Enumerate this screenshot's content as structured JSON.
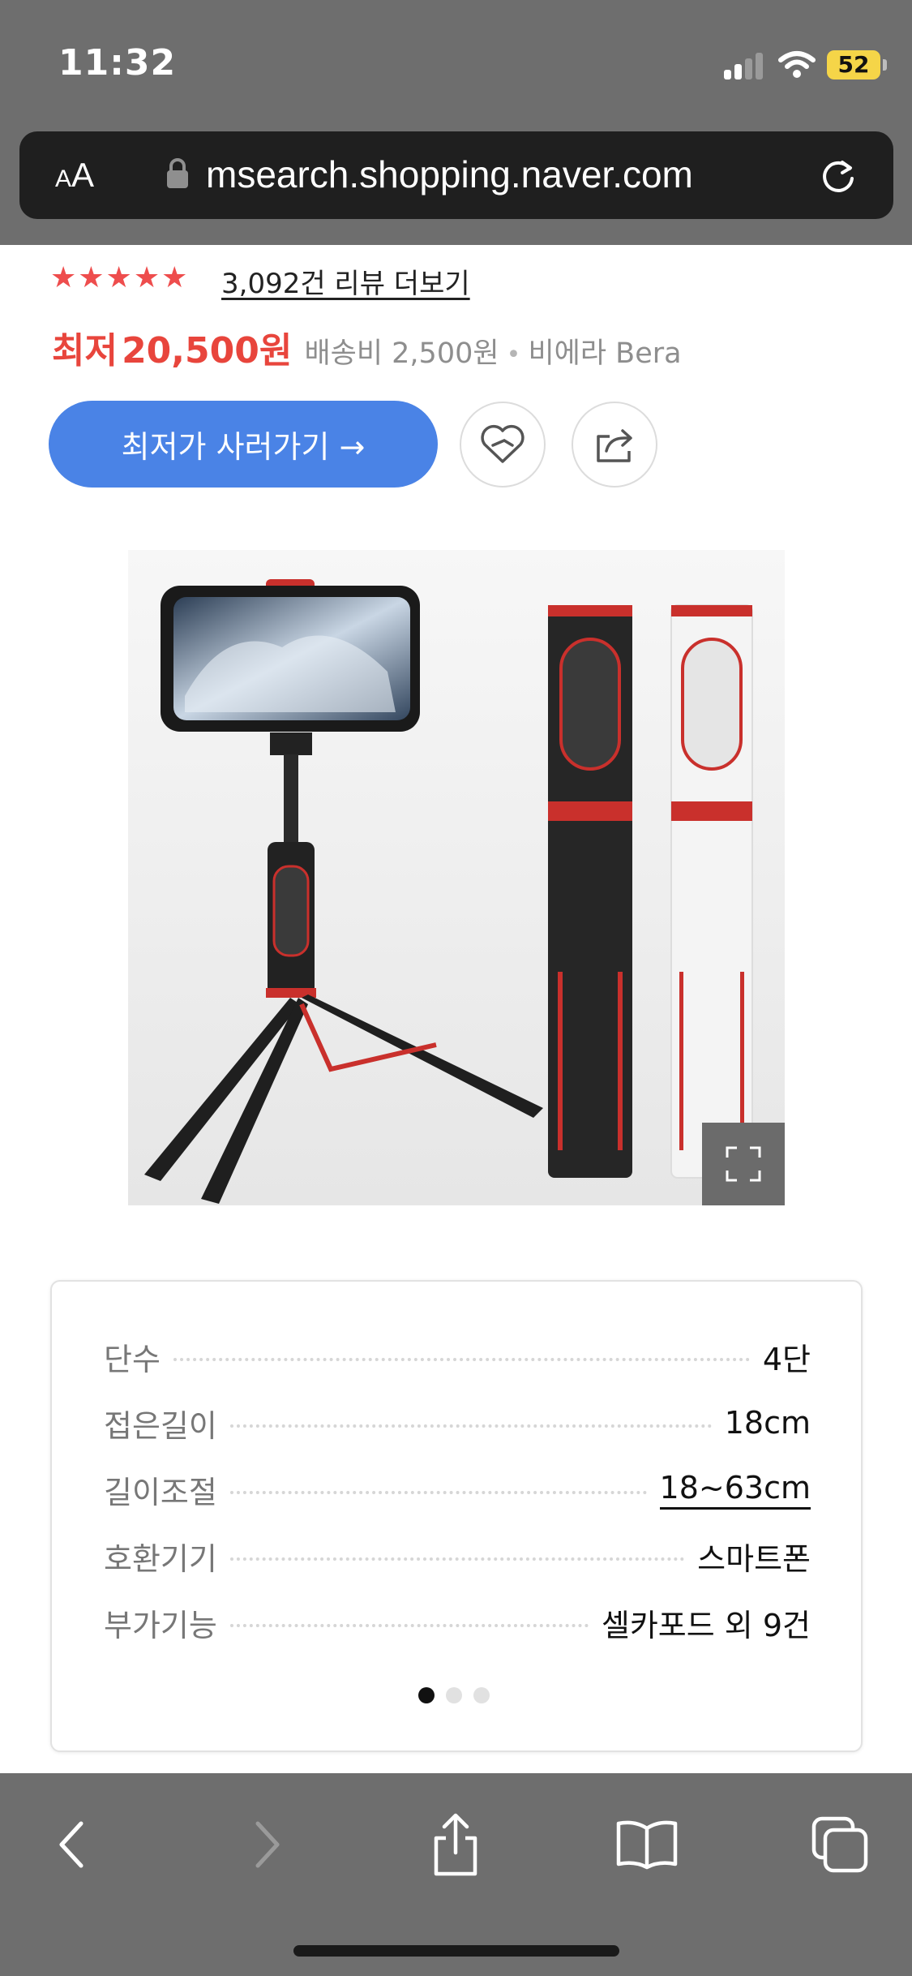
{
  "status_bar": {
    "time": "11:32",
    "battery": "52"
  },
  "browser": {
    "text_size_label_small": "A",
    "text_size_label_large": "A",
    "url": "msearch.shopping.naver.com"
  },
  "product": {
    "rating_stars": "★★★★★",
    "review_link": "3,092건 리뷰 더보기",
    "price_label": "최저",
    "price_value": "20,500원",
    "shipping": "배송비 2,500원",
    "separator": "•",
    "seller": "비에라 Bera",
    "buy_button": "최저가 사러가기 →"
  },
  "specs": [
    {
      "label": "단수",
      "value": "4단"
    },
    {
      "label": "접은길이",
      "value": "18cm"
    },
    {
      "label": "길이조절",
      "value": "18~63cm"
    },
    {
      "label": "호환기기",
      "value": "스마트폰"
    },
    {
      "label": "부가기능",
      "value": "셀카포드 외 9건"
    }
  ],
  "pager": {
    "total": 3,
    "active_index": 0
  },
  "colors": {
    "chrome": "#6e6e6e",
    "price_red": "#e8453c",
    "star_red": "#ee4d4d",
    "buy_blue": "#4a83e6",
    "battery_yellow": "#f5d548"
  },
  "icons": {
    "status": [
      "signal-icon",
      "wifi-icon",
      "battery-icon"
    ],
    "browser": [
      "lock-icon",
      "reload-icon"
    ],
    "actions": [
      "heart-icon",
      "share-icon",
      "expand-icon"
    ],
    "toolbar": [
      "back-icon",
      "forward-icon",
      "share-icon",
      "bookmarks-icon",
      "tabs-icon"
    ]
  }
}
